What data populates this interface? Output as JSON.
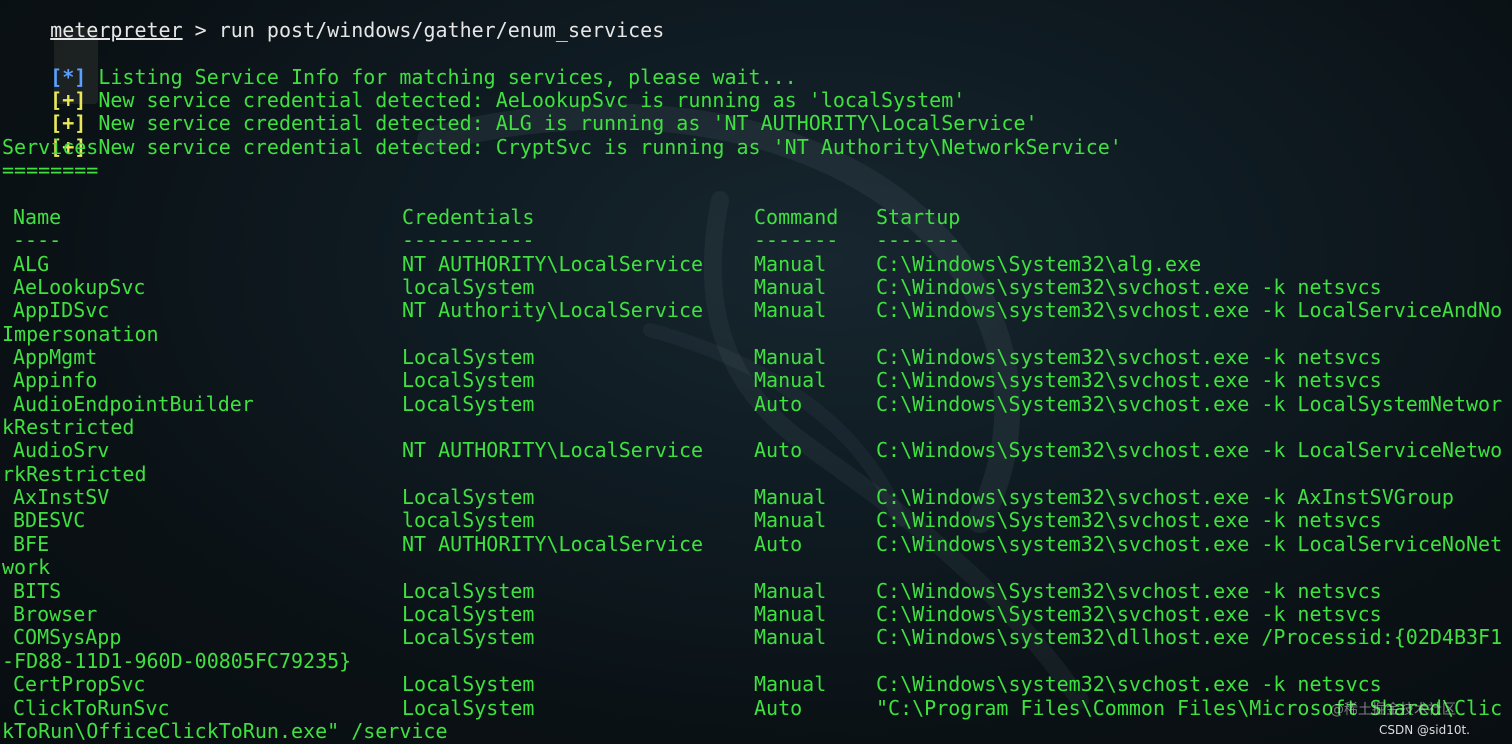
{
  "terminal": {
    "prompt_user": "meterpreter",
    "prompt_sep": " > ",
    "command": "run post/windows/gather/enum_services",
    "messages": [
      {
        "tag": "[*]",
        "text": " Listing Service Info for matching services, please wait..."
      },
      {
        "tag": "[+]",
        "text": " New service credential detected: AeLookupSvc is running as 'localSystem'"
      },
      {
        "tag": "[+]",
        "text": " New service credential detected: ALG is running as 'NT AUTHORITY\\LocalService'"
      },
      {
        "tag": "[+]",
        "text": " New service credential detected: CryptSvc is running as 'NT Authority\\NetworkService'"
      }
    ],
    "section_title": "Services",
    "section_underline": "========",
    "table": {
      "headers": {
        "name": "Name",
        "credentials": "Credentials",
        "command": "Command",
        "startup": "Startup"
      },
      "separators": {
        "name": "----",
        "credentials": "-----------",
        "command": "-------",
        "startup": "-------"
      },
      "rows": [
        {
          "name": "ALG",
          "credentials": "NT AUTHORITY\\LocalService",
          "command": "Manual",
          "startup": "C:\\Windows\\System32\\alg.exe",
          "wrap": ""
        },
        {
          "name": "AeLookupSvc",
          "credentials": "localSystem",
          "command": "Manual",
          "startup": "C:\\Windows\\system32\\svchost.exe -k netsvcs",
          "wrap": ""
        },
        {
          "name": "AppIDSvc",
          "credentials": "NT Authority\\LocalService",
          "command": "Manual",
          "startup": "C:\\Windows\\system32\\svchost.exe -k LocalServiceAndNo",
          "wrap": "Impersonation"
        },
        {
          "name": "AppMgmt",
          "credentials": "LocalSystem",
          "command": "Manual",
          "startup": "C:\\Windows\\system32\\svchost.exe -k netsvcs",
          "wrap": ""
        },
        {
          "name": "Appinfo",
          "credentials": "LocalSystem",
          "command": "Manual",
          "startup": "C:\\Windows\\system32\\svchost.exe -k netsvcs",
          "wrap": ""
        },
        {
          "name": "AudioEndpointBuilder",
          "credentials": "LocalSystem",
          "command": "Auto",
          "startup": "C:\\Windows\\System32\\svchost.exe -k LocalSystemNetwor",
          "wrap": "kRestricted"
        },
        {
          "name": "AudioSrv",
          "credentials": "NT AUTHORITY\\LocalService",
          "command": "Auto",
          "startup": "C:\\Windows\\System32\\svchost.exe -k LocalServiceNetwo",
          "wrap": "rkRestricted"
        },
        {
          "name": "AxInstSV",
          "credentials": "LocalSystem",
          "command": "Manual",
          "startup": "C:\\Windows\\system32\\svchost.exe -k AxInstSVGroup",
          "wrap": ""
        },
        {
          "name": "BDESVC",
          "credentials": "localSystem",
          "command": "Manual",
          "startup": "C:\\Windows\\System32\\svchost.exe -k netsvcs",
          "wrap": ""
        },
        {
          "name": "BFE",
          "credentials": "NT AUTHORITY\\LocalService",
          "command": "Auto",
          "startup": "C:\\Windows\\system32\\svchost.exe -k LocalServiceNoNet",
          "wrap": "work"
        },
        {
          "name": "BITS",
          "credentials": "LocalSystem",
          "command": "Manual",
          "startup": "C:\\Windows\\System32\\svchost.exe -k netsvcs",
          "wrap": ""
        },
        {
          "name": "Browser",
          "credentials": "LocalSystem",
          "command": "Manual",
          "startup": "C:\\Windows\\System32\\svchost.exe -k netsvcs",
          "wrap": ""
        },
        {
          "name": "COMSysApp",
          "credentials": "LocalSystem",
          "command": "Manual",
          "startup": "C:\\Windows\\system32\\dllhost.exe /Processid:{02D4B3F1",
          "wrap": "-FD88-11D1-960D-00805FC79235}"
        },
        {
          "name": "CertPropSvc",
          "credentials": "LocalSystem",
          "command": "Manual",
          "startup": "C:\\Windows\\system32\\svchost.exe -k netsvcs",
          "wrap": ""
        },
        {
          "name": "ClickToRunSvc",
          "credentials": "LocalSystem",
          "command": "Auto",
          "startup": "\"C:\\Program Files\\Common Files\\Microsoft Shared\\Clic",
          "wrap": "kToRun\\OfficeClickToRun.exe\" /service"
        }
      ]
    }
  },
  "overlay": {
    "badge": "@稀土掘金技术社区",
    "watermark": "CSDN @sid10t."
  },
  "colors": {
    "text": "#3fe03f",
    "prompt": "#e6e6e6",
    "info_tag": "#5aa0ff",
    "good_tag": "#e8e85a",
    "background": "#0f1b22"
  }
}
